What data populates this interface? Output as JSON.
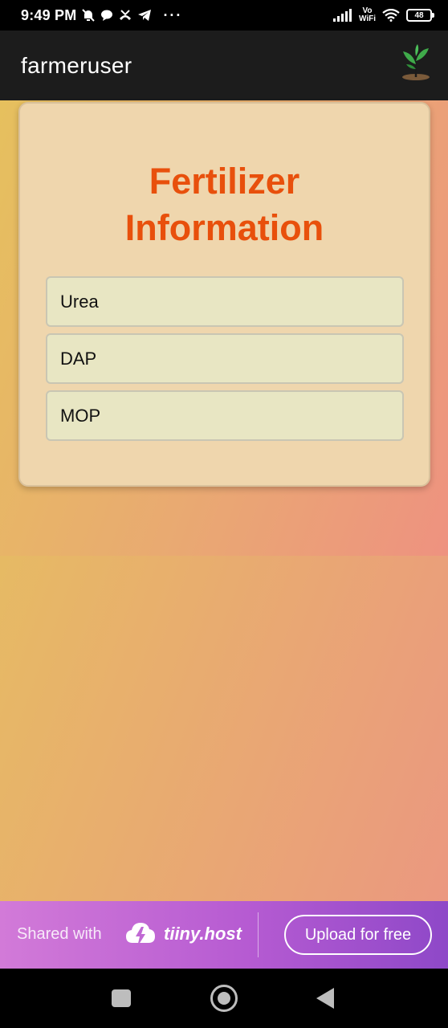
{
  "status_bar": {
    "time": "9:49 PM",
    "dots": "···",
    "volte_top": "Vo",
    "volte_bottom": "WiFi",
    "battery": "48",
    "icons": [
      "mute-icon",
      "chat-bubble-icon",
      "missed-call-icon",
      "telegram-icon",
      "signal-icon",
      "wifi-icon",
      "battery-icon"
    ]
  },
  "app_bar": {
    "title": "farmeruser",
    "logo_icon": "plant-sprout-icon"
  },
  "card": {
    "title_line1": "Fertilizer",
    "title_line2": "Information",
    "items": [
      {
        "label": "Urea"
      },
      {
        "label": "DAP"
      },
      {
        "label": "MOP"
      }
    ]
  },
  "share_banner": {
    "shared_text": "Shared with",
    "brand": "tiiny.host",
    "upload_label": "Upload for free",
    "logo_icon": "cloud-bolt-icon"
  },
  "nav_bar": {
    "icons": [
      "recents-square-icon",
      "home-circle-icon",
      "back-triangle-icon"
    ]
  },
  "colors": {
    "title_accent": "#e8500c",
    "card_bg": "#efd6ad",
    "item_bg": "#e8e6c3",
    "app_bar_bg": "#1c1c1c",
    "banner_start": "#d27ad8",
    "banner_end": "#8e48c8"
  }
}
